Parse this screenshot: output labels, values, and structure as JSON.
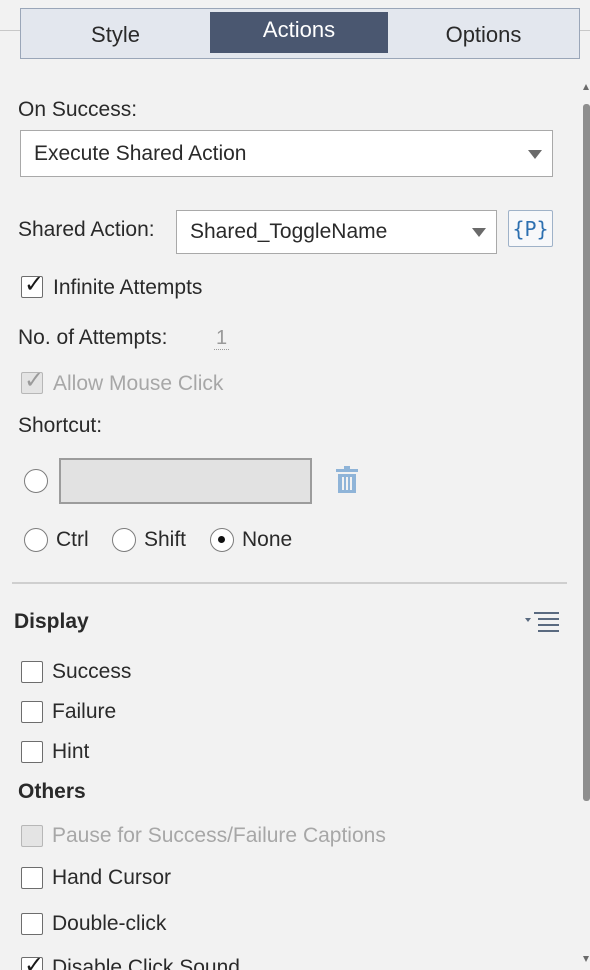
{
  "tabs": [
    {
      "label": "Style",
      "active": false
    },
    {
      "label": "Actions",
      "active": true
    },
    {
      "label": "Options",
      "active": false
    }
  ],
  "on_success": {
    "label": "On Success:",
    "value": "Execute Shared Action"
  },
  "shared_action": {
    "label": "Shared Action:",
    "value": "Shared_ToggleName",
    "param_button": "{P}"
  },
  "infinite_attempts": {
    "label": "Infinite Attempts",
    "checked": true
  },
  "attempts": {
    "label": "No. of Attempts:",
    "value": "1"
  },
  "allow_mouse_click": {
    "label": "Allow Mouse Click",
    "checked": true,
    "disabled": true
  },
  "shortcut": {
    "label": "Shortcut:",
    "value": "",
    "modifiers": [
      {
        "label": "Ctrl",
        "selected": false
      },
      {
        "label": "Shift",
        "selected": false
      },
      {
        "label": "None",
        "selected": true
      }
    ]
  },
  "display": {
    "heading": "Display",
    "items": [
      {
        "label": "Success",
        "checked": false
      },
      {
        "label": "Failure",
        "checked": false
      },
      {
        "label": "Hint",
        "checked": false
      }
    ]
  },
  "others": {
    "heading": "Others",
    "items": [
      {
        "label": "Pause for Success/Failure Captions",
        "checked": false,
        "disabled": true
      },
      {
        "label": "Hand Cursor",
        "checked": false
      },
      {
        "label": "Double-click",
        "checked": false
      },
      {
        "label": "Disable Click Sound",
        "checked": true
      }
    ]
  },
  "icons": {
    "trash": "trash-icon",
    "menu": "list-menu-icon",
    "caret": "chevron-down-icon"
  },
  "colors": {
    "active_tab": "#4a5770",
    "tab_bar": "#e3e7ee",
    "param_text": "#2c6fb0",
    "trash": "#8fb4d8"
  }
}
